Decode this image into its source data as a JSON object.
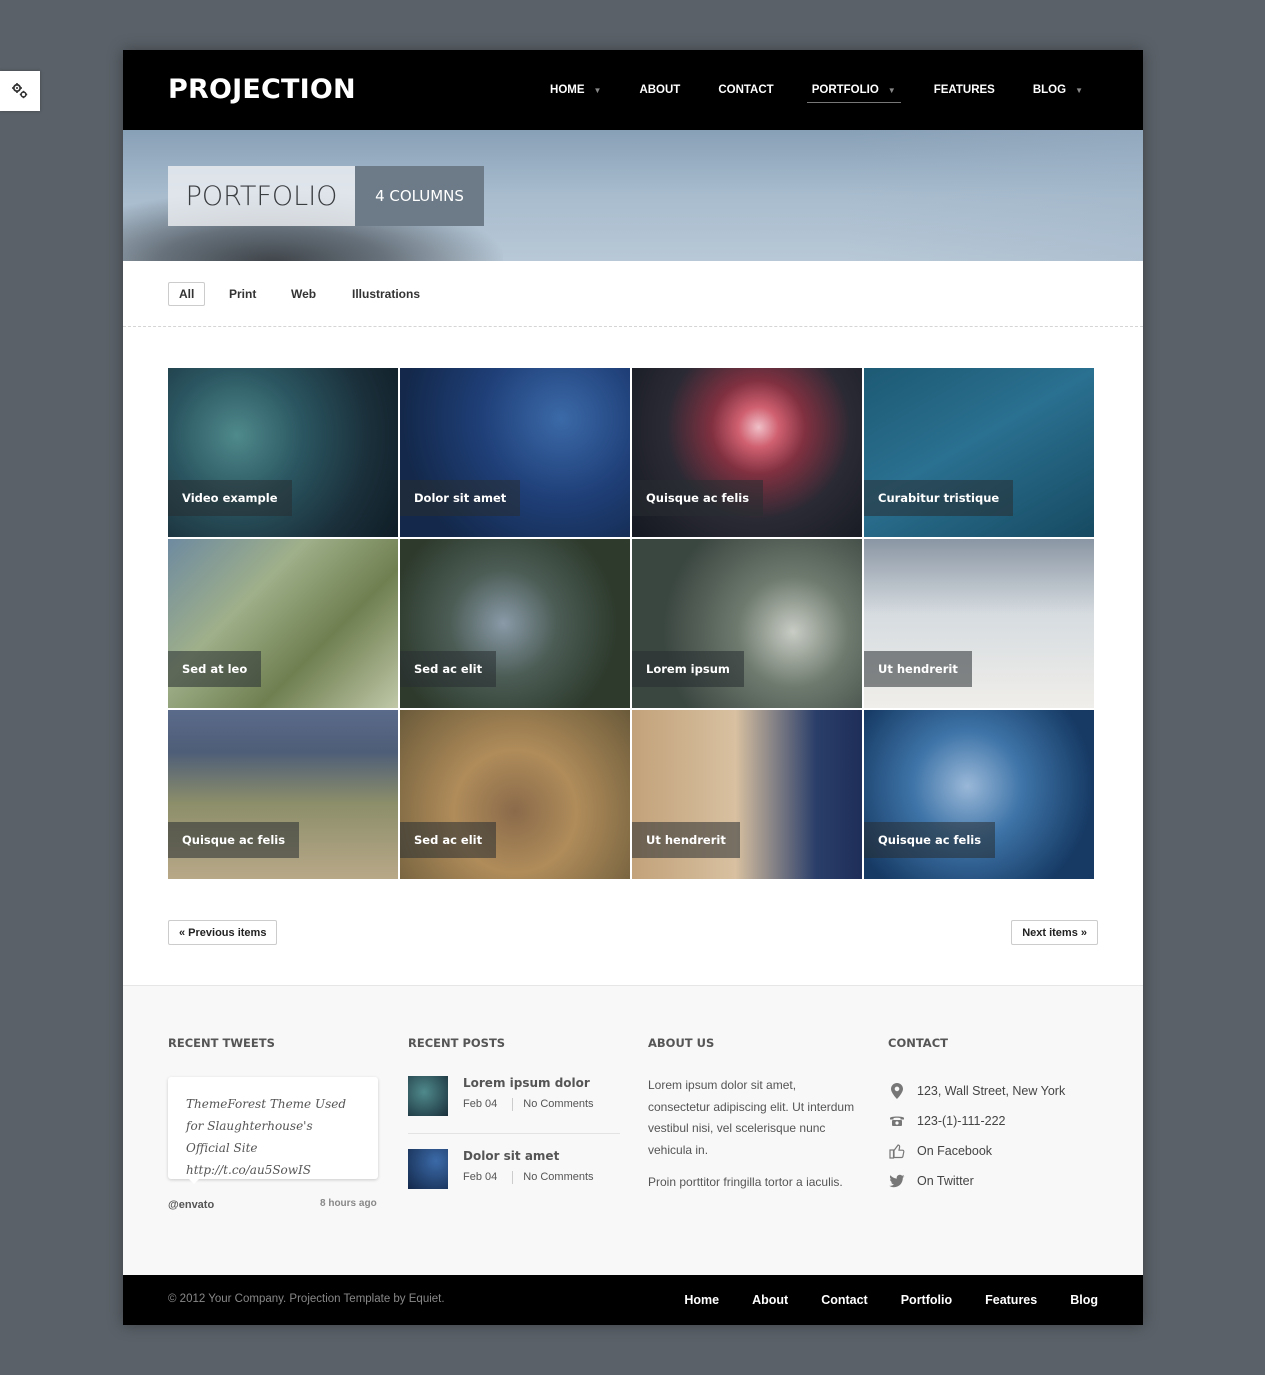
{
  "site": {
    "logo": "PROJECTION"
  },
  "nav": {
    "items": [
      {
        "label": "HOME",
        "dropdown": true
      },
      {
        "label": "ABOUT",
        "dropdown": false
      },
      {
        "label": "CONTACT",
        "dropdown": false
      },
      {
        "label": "PORTFOLIO",
        "dropdown": true,
        "active": true
      },
      {
        "label": "FEATURES",
        "dropdown": false
      },
      {
        "label": "BLOG",
        "dropdown": true
      }
    ]
  },
  "banner": {
    "title": "PORTFOLIO",
    "subtitle": "4 COLUMNS"
  },
  "filters": [
    {
      "label": "All",
      "active": true
    },
    {
      "label": "Print",
      "active": false
    },
    {
      "label": "Web",
      "active": false
    },
    {
      "label": "Illustrations",
      "active": false
    }
  ],
  "portfolio": {
    "items": [
      {
        "label": "Video example"
      },
      {
        "label": "Dolor sit amet"
      },
      {
        "label": "Quisque ac felis"
      },
      {
        "label": "Curabitur tristique"
      },
      {
        "label": "Sed at leo"
      },
      {
        "label": "Sed ac elit"
      },
      {
        "label": "Lorem ipsum"
      },
      {
        "label": "Ut hendrerit"
      },
      {
        "label": "Quisque ac felis"
      },
      {
        "label": "Sed ac elit"
      },
      {
        "label": "Ut hendrerit"
      },
      {
        "label": "Quisque ac felis"
      }
    ]
  },
  "pager": {
    "prev": "« Previous items",
    "next": "Next items »"
  },
  "footer": {
    "tweets": {
      "heading": "RECENT TWEETS",
      "text": "ThemeForest Theme Used for Slaughterhouse's Official Site http://t.co/au5SowIS",
      "user": "@envato",
      "time": "8 hours ago"
    },
    "posts": {
      "heading": "RECENT POSTS",
      "items": [
        {
          "title": "Lorem ipsum dolor",
          "date": "Feb 04",
          "comments": "No Comments"
        },
        {
          "title": "Dolor sit amet",
          "date": "Feb 04",
          "comments": "No Comments"
        }
      ]
    },
    "about": {
      "heading": "ABOUT US",
      "p1": "Lorem ipsum dolor sit amet, consectetur adipiscing elit. Ut interdum vestibul nisi, vel scelerisque nunc vehicula in.",
      "p2": "Proin porttitor fringilla tortor a iaculis."
    },
    "contact": {
      "heading": "CONTACT",
      "items": [
        {
          "icon": "map-pin-icon",
          "text": "123, Wall Street, New York"
        },
        {
          "icon": "phone-icon",
          "text": "123-(1)-111-222"
        },
        {
          "icon": "thumbs-up-icon",
          "text": "On Facebook"
        },
        {
          "icon": "twitter-bird-icon",
          "text": "On Twitter"
        }
      ]
    }
  },
  "bottom": {
    "copyright": "© 2012 Your Company. Projection Template by Equiet.",
    "nav": [
      "Home",
      "About",
      "Contact",
      "Portfolio",
      "Features",
      "Blog"
    ]
  },
  "colors": {
    "header_bg": "#000000",
    "page_bg": "#5a6168",
    "footer_bg": "#f8f8f8",
    "accent_box": "#6c7b87"
  }
}
